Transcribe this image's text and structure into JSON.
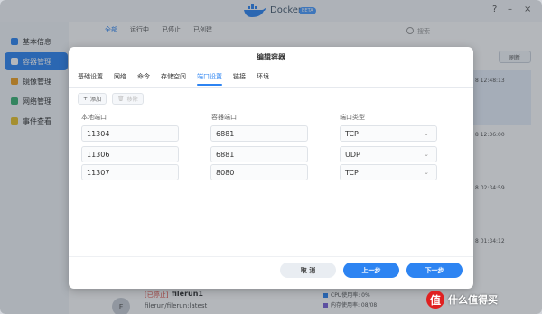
{
  "app": {
    "title": "Docker",
    "badge": "BETA"
  },
  "sidebar": {
    "items": [
      {
        "label": "基本信息",
        "active": false
      },
      {
        "label": "容器管理",
        "active": true
      },
      {
        "label": "镜像管理",
        "active": false
      },
      {
        "label": "网络管理",
        "active": false
      },
      {
        "label": "事件查看",
        "active": false
      }
    ]
  },
  "main": {
    "tabs": [
      "全部",
      "运行中",
      "已停止",
      "已创建"
    ],
    "search_placeholder": "搜索",
    "refresh_label": "刷新",
    "times": [
      "8 12:48:13",
      "8 12:36:00",
      "8 02:34:59",
      "8 01:34:12"
    ],
    "container": {
      "status": "[已停止]",
      "name": "filerun1",
      "image": "filerun/filerun:latest",
      "avatar_letter": "F",
      "cpu": "CPU使用率: 0%",
      "mem": "内存使用率: 08/08"
    }
  },
  "dialog": {
    "title": "编辑容器",
    "tabs": [
      "基础设置",
      "网络",
      "命令",
      "存储空间",
      "端口设置",
      "链接",
      "环境"
    ],
    "active_tab": 4,
    "add_label": "添加",
    "remove_label": "移除",
    "headers": {
      "local_port": "本地端口",
      "container_port": "容器端口",
      "port_type": "端口类型"
    },
    "rows": [
      {
        "local": "11304",
        "container": "6881",
        "type": "TCP"
      },
      {
        "local": "11306",
        "container": "6881",
        "type": "UDP"
      },
      {
        "local": "11307",
        "container": "8080",
        "type": "TCP"
      }
    ],
    "cancel_label": "取 消",
    "prev_label": "上一步",
    "next_label": "下一步"
  },
  "watermark": {
    "badge": "值",
    "text": "什么值得买"
  },
  "colors": {
    "accent": "#2d84f2",
    "stopped": "#e0483e"
  }
}
